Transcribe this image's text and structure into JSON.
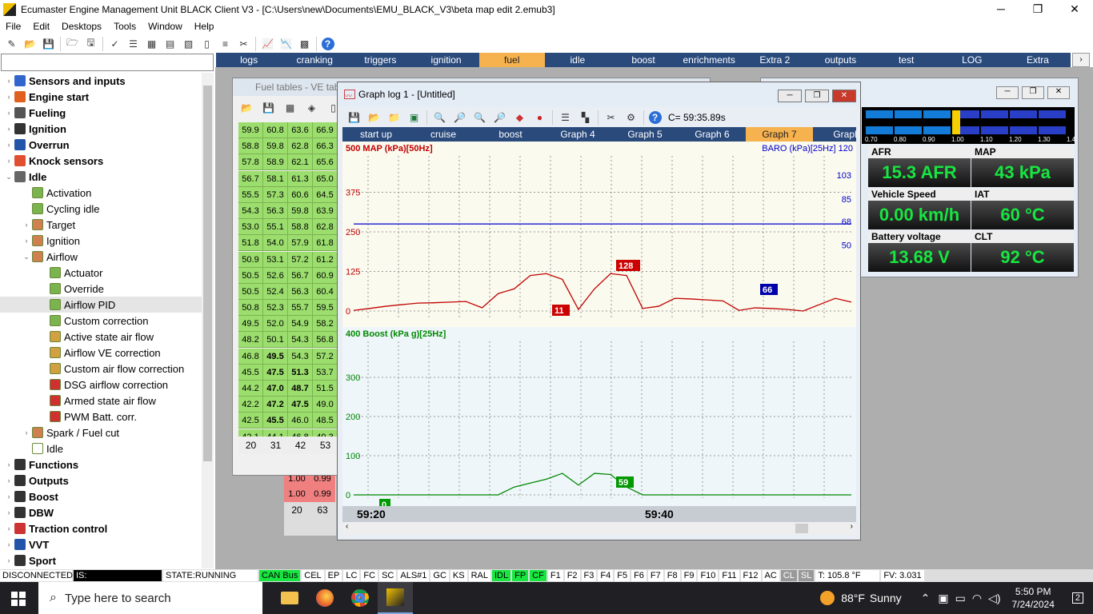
{
  "titlebar": {
    "title": "Ecumaster Engine Management Unit BLACK Client V3 - [C:\\Users\\new\\Documents\\EMU_BLACK_V3\\beta map edit 2.emub3]",
    "minimize": "─",
    "restore": "❐",
    "close": "✕"
  },
  "menu": [
    "File",
    "Edit",
    "Desktops",
    "Tools",
    "Window",
    "Help"
  ],
  "tabs": [
    "logs",
    "cranking",
    "triggers",
    "ignition",
    "fuel",
    "idle",
    "boost",
    "enrichments",
    "Extra 2",
    "outputs",
    "test",
    "LOG",
    "Extra"
  ],
  "tabs_active": "fuel",
  "tree": [
    {
      "label": "Sensors and inputs",
      "bold": true,
      "level": 0,
      "arrow": "›",
      "color": "#3366cc"
    },
    {
      "label": "Engine start",
      "bold": true,
      "level": 0,
      "arrow": "›",
      "color": "#e06020"
    },
    {
      "label": "Fueling",
      "bold": true,
      "level": 0,
      "arrow": "›",
      "color": "#555"
    },
    {
      "label": "Ignition",
      "bold": true,
      "level": 0,
      "arrow": "›",
      "color": "#333"
    },
    {
      "label": "Overrun",
      "bold": true,
      "level": 0,
      "arrow": "›",
      "color": "#2255aa"
    },
    {
      "label": "Knock sensors",
      "bold": true,
      "level": 0,
      "arrow": "›",
      "color": "#e05030"
    },
    {
      "label": "Idle",
      "bold": true,
      "level": 0,
      "arrow": "⌄",
      "color": "#666"
    },
    {
      "label": "Activation",
      "level": 1,
      "arrow": "",
      "color": "#7bb34e"
    },
    {
      "label": "Cycling idle",
      "level": 1,
      "arrow": "",
      "color": "#7bb34e"
    },
    {
      "label": "Target",
      "level": 1,
      "arrow": "›",
      "color": "#d08050"
    },
    {
      "label": "Ignition",
      "level": 1,
      "arrow": "›",
      "color": "#d08050"
    },
    {
      "label": "Airflow",
      "level": 1,
      "arrow": "⌄",
      "color": "#d08050"
    },
    {
      "label": "Actuator",
      "level": 2,
      "arrow": "",
      "color": "#7bb34e"
    },
    {
      "label": "Override",
      "level": 2,
      "arrow": "",
      "color": "#7bb34e"
    },
    {
      "label": "Airflow PID",
      "level": 2,
      "arrow": "",
      "color": "#7bb34e",
      "selected": true
    },
    {
      "label": "Custom correction",
      "level": 2,
      "arrow": "",
      "color": "#7bb34e"
    },
    {
      "label": "Active state air flow",
      "level": 2,
      "arrow": "",
      "color": "#d2a040"
    },
    {
      "label": "Airflow VE correction",
      "level": 2,
      "arrow": "",
      "color": "#d2a040"
    },
    {
      "label": "Custom air flow correction",
      "level": 2,
      "arrow": "",
      "color": "#d2a040"
    },
    {
      "label": "DSG airflow correction",
      "level": 2,
      "arrow": "",
      "color": "#d03030"
    },
    {
      "label": "Armed state air flow",
      "level": 2,
      "arrow": "",
      "color": "#d03030"
    },
    {
      "label": "PWM Batt. corr.",
      "level": 2,
      "arrow": "",
      "color": "#d03030"
    },
    {
      "label": "Spark / Fuel cut",
      "level": 1,
      "arrow": "›",
      "color": "#d08050"
    },
    {
      "label": "Idle",
      "level": 1,
      "arrow": "",
      "color": "#fff"
    },
    {
      "label": "Functions",
      "bold": true,
      "level": 0,
      "arrow": "›",
      "color": "#333"
    },
    {
      "label": "Outputs",
      "bold": true,
      "level": 0,
      "arrow": "›",
      "color": "#333"
    },
    {
      "label": "Boost",
      "bold": true,
      "level": 0,
      "arrow": "›",
      "color": "#333"
    },
    {
      "label": "DBW",
      "bold": true,
      "level": 0,
      "arrow": "›",
      "color": "#333"
    },
    {
      "label": "Traction control",
      "bold": true,
      "level": 0,
      "arrow": "›",
      "color": "#cc3333"
    },
    {
      "label": "VVT",
      "bold": true,
      "level": 0,
      "arrow": "›",
      "color": "#2255aa"
    },
    {
      "label": "Sport",
      "bold": true,
      "level": 0,
      "arrow": "›",
      "color": "#333"
    }
  ],
  "fuel_window": {
    "title": "Fuel tables - VE tab"
  },
  "ve_table": {
    "rows": [
      [
        "59.9",
        "60.8",
        "63.6",
        "66.9"
      ],
      [
        "58.8",
        "59.8",
        "62.8",
        "66.3"
      ],
      [
        "57.8",
        "58.9",
        "62.1",
        "65.6"
      ],
      [
        "56.7",
        "58.1",
        "61.3",
        "65.0"
      ],
      [
        "55.5",
        "57.3",
        "60.6",
        "64.5"
      ],
      [
        "54.3",
        "56.3",
        "59.8",
        "63.9"
      ],
      [
        "53.0",
        "55.1",
        "58.8",
        "62.8"
      ],
      [
        "51.8",
        "54.0",
        "57.9",
        "61.8"
      ],
      [
        "50.9",
        "53.1",
        "57.2",
        "61.2"
      ],
      [
        "50.5",
        "52.6",
        "56.7",
        "60.9"
      ],
      [
        "50.5",
        "52.4",
        "56.3",
        "60.4"
      ],
      [
        "50.8",
        "52.3",
        "55.7",
        "59.5"
      ],
      [
        "49.5",
        "52.0",
        "54.9",
        "58.2"
      ],
      [
        "48.2",
        "50.1",
        "54.3",
        "56.8"
      ],
      [
        "46.8",
        "49.5",
        "54.3",
        "57.2"
      ],
      [
        "45.5",
        "47.5",
        "51.3",
        "53.7"
      ],
      [
        "44.2",
        "47.0",
        "48.7",
        "51.5"
      ],
      [
        "42.2",
        "47.2",
        "47.5",
        "49.0"
      ],
      [
        "42.5",
        "45.5",
        "46.0",
        "48.5"
      ],
      [
        "42.1",
        "44.1",
        "46.8",
        "49.3"
      ]
    ],
    "bold": [
      [
        14,
        1
      ],
      [
        15,
        1
      ],
      [
        15,
        2
      ],
      [
        16,
        1
      ],
      [
        16,
        2
      ],
      [
        17,
        1
      ],
      [
        17,
        2
      ],
      [
        18,
        1
      ]
    ],
    "col_headers": [
      "20",
      "31",
      "42",
      "53"
    ]
  },
  "bg_table": {
    "cells": [
      [
        "1.00",
        "0.99"
      ],
      [
        "1.00",
        "0.99"
      ]
    ],
    "headers": [
      "20",
      "63"
    ]
  },
  "graph": {
    "title": "Graph log 1 - [Untitled]",
    "cursor_time": "C= 59:35.89s",
    "tabs": [
      "start up",
      "cruise",
      "boost",
      "Graph 4",
      "Graph 5",
      "Graph 6",
      "Graph 7",
      "Graph"
    ],
    "active_tab": "Graph 7",
    "times": [
      "59:20",
      "59:40"
    ]
  },
  "chart_data": [
    {
      "type": "line",
      "title": "",
      "ylabel": "500 MAP (kPa)[50Hz]",
      "ylabel2": "BARO (kPa)[25Hz] 120",
      "ylim": [
        0,
        500
      ],
      "y2lim": [
        0,
        120
      ],
      "yticks": [
        "375",
        "250",
        "125",
        "0"
      ],
      "y2ticks": [
        "103",
        "85",
        "68",
        "50"
      ],
      "series": [
        {
          "name": "MAP (kPa)[50Hz]",
          "color": "#c00000",
          "values": [
            2,
            8,
            15,
            20,
            25,
            26,
            28,
            30,
            10,
            55,
            70,
            112,
            118,
            100,
            5,
            70,
            118,
            112,
            8,
            15,
            40,
            38,
            35,
            32,
            2,
            10,
            8,
            5,
            0,
            20,
            40,
            28
          ]
        },
        {
          "name": "BARO (kPa)[25Hz]",
          "color": "#0000cc",
          "values": [
            66,
            66,
            66,
            66,
            66,
            66,
            66,
            66,
            66,
            66,
            66,
            66,
            66,
            66,
            66,
            66,
            66,
            66,
            66,
            66,
            66,
            66,
            66,
            66,
            66,
            66,
            66,
            66,
            66,
            66,
            66,
            66
          ]
        }
      ],
      "annotations": [
        "128",
        "11",
        "66"
      ]
    },
    {
      "type": "line",
      "title": "",
      "ylabel": "400 Boost (kPa g)[25Hz]",
      "ylim": [
        0,
        400
      ],
      "yticks": [
        "300",
        "200",
        "100",
        "0"
      ],
      "series": [
        {
          "name": "Boost (kPa g)[25Hz]",
          "color": "#008800",
          "values": [
            0,
            0,
            0,
            0,
            0,
            0,
            0,
            0,
            0,
            0,
            20,
            30,
            40,
            55,
            25,
            55,
            52,
            20,
            0,
            0,
            0,
            0,
            0,
            0,
            0,
            0,
            0,
            0,
            0,
            0,
            0,
            0
          ]
        }
      ],
      "annotations": [
        "0",
        "59"
      ]
    }
  ],
  "gauges": {
    "afr": {
      "label": "AFR",
      "value": "15.3 AFR"
    },
    "map": {
      "label": "MAP",
      "value": "43 kPa"
    },
    "speed": {
      "label": "Vehicle Speed",
      "value": "0.00 km/h"
    },
    "iat": {
      "label": "IAT",
      "value": "60 °C"
    },
    "batt": {
      "label": "Battery voltage",
      "value": "13.68 V"
    },
    "clt": {
      "label": "CLT",
      "value": "92 °C"
    },
    "lambda_ticks": [
      "0.70",
      "0.80",
      "0.90",
      "1.00",
      "1.10",
      "1.20",
      "1.30",
      "1.40"
    ]
  },
  "status": {
    "conn": "DISCONNECTED",
    "is": "IS:",
    "state": "STATE:RUNNING",
    "can": "CAN Bus",
    "flags": [
      "CEL",
      "EP",
      "LC",
      "FC",
      "SC",
      "ALS#1",
      "GC",
      "KS",
      "RAL",
      "IDL",
      "FP",
      "CF",
      "F1",
      "F2",
      "F3",
      "F4",
      "F5",
      "F6",
      "F7",
      "F8",
      "F9",
      "F10",
      "F11",
      "F12",
      "AC",
      "CL",
      "SL"
    ],
    "temp": "T: 105.8 °F",
    "fv": "FV: 3.031"
  },
  "taskbar": {
    "search": "Type here to search",
    "weather_temp": "88°F",
    "weather": "Sunny",
    "time": "5:50 PM",
    "date": "7/24/2024",
    "notif": "2"
  },
  "icons": [
    "windows-icon",
    "search-icon",
    "folder-icon",
    "firefox-icon",
    "chrome-icon",
    "emu-icon"
  ]
}
